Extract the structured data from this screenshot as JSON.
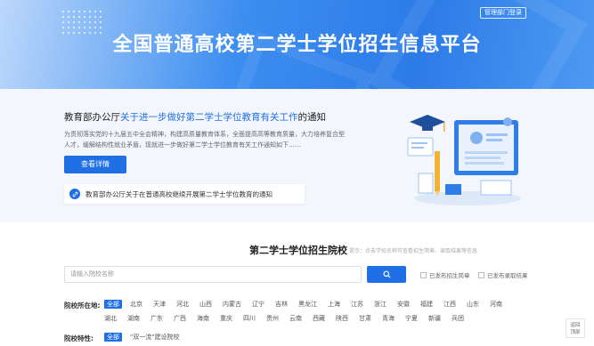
{
  "header": {
    "title": "全国普通高校第二学士学位招生信息平台",
    "login_label": "管理部门登录"
  },
  "notice": {
    "title_prefix": "教育部办公厅",
    "title_link": "关于进一步做好第二学士学位教育有关工作",
    "title_suffix": "的通知",
    "body": "为贯彻落实党的十九届五中全会精神，构建高质量教育体系，全面提高高等教育质量，大力培养复合型人才，缓解结构性就业矛盾，现就进一步做好第二学士学位教育有关工作通知如下……",
    "detail_button": "查看详情",
    "related_link": "教育部办公厅关于在普通高校继续开展第二学士学位教育的通知"
  },
  "search": {
    "section_title": "第二学士学位招生院校",
    "hint": "提示：点击学校名称可查看招生简章、录取结果等信息",
    "placeholder": "请输入院校名称",
    "checkbox_1": "已发布招生简章",
    "checkbox_2": "已发布录取结果"
  },
  "filters": {
    "region_label": "院校所在地:",
    "regions": [
      "全部",
      "北京",
      "天津",
      "河北",
      "山西",
      "内蒙古",
      "辽宁",
      "吉林",
      "黑龙江",
      "上海",
      "江苏",
      "浙江",
      "安徽",
      "福建",
      "江西",
      "山东",
      "河南",
      "湖北",
      "湖南",
      "广东",
      "广西",
      "海南",
      "重庆",
      "四川",
      "贵州",
      "云南",
      "西藏",
      "陕西",
      "甘肃",
      "青海",
      "宁夏",
      "新疆",
      "兵团"
    ],
    "feature_label": "院校特性:",
    "features": [
      "全部",
      "\"双一流\"建设院校"
    ]
  },
  "back_top": {
    "line1": "返回",
    "line2": "顶部"
  },
  "colors": {
    "accent": "#1f6fe5",
    "notice_bg": "#f3f7fd"
  }
}
